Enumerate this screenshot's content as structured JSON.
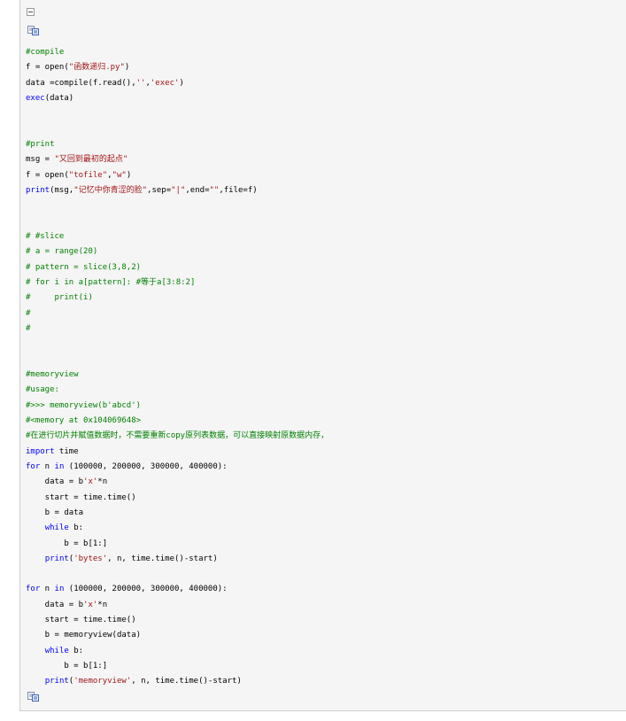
{
  "toolbar": {
    "collapse_icon": "minus-box-icon",
    "copy_icon": "copy-code-icon"
  },
  "colors": {
    "comment": "#008000",
    "keyword": "#0000ff",
    "string": "#a31515",
    "plain": "#000000",
    "background": "#f5f5f5",
    "border": "#cfcfcf"
  },
  "code": [
    [
      {
        "t": "#compile",
        "c": "c"
      }
    ],
    [
      {
        "t": "f = open(",
        "c": ""
      },
      {
        "t": "\"函数递归.py\"",
        "c": "s"
      },
      {
        "t": ")",
        "c": ""
      }
    ],
    [
      {
        "t": "data =compile(f.read(),",
        "c": ""
      },
      {
        "t": "''",
        "c": "s"
      },
      {
        "t": ",",
        "c": ""
      },
      {
        "t": "'exec'",
        "c": "s"
      },
      {
        "t": ")",
        "c": ""
      }
    ],
    [
      {
        "t": "exec",
        "c": "k"
      },
      {
        "t": "(data)",
        "c": ""
      }
    ],
    [],
    [],
    [
      {
        "t": "#print",
        "c": "c"
      }
    ],
    [
      {
        "t": "msg = ",
        "c": ""
      },
      {
        "t": "\"又回到最初的起点\"",
        "c": "s"
      }
    ],
    [
      {
        "t": "f = open(",
        "c": ""
      },
      {
        "t": "\"tofile\"",
        "c": "s"
      },
      {
        "t": ",",
        "c": ""
      },
      {
        "t": "\"w\"",
        "c": "s"
      },
      {
        "t": ")",
        "c": ""
      }
    ],
    [
      {
        "t": "print",
        "c": "k"
      },
      {
        "t": "(msg,",
        "c": ""
      },
      {
        "t": "\"记忆中你青涩的脸\"",
        "c": "s"
      },
      {
        "t": ",sep=",
        "c": ""
      },
      {
        "t": "\"|\"",
        "c": "s"
      },
      {
        "t": ",end=",
        "c": ""
      },
      {
        "t": "\"\"",
        "c": "s"
      },
      {
        "t": ",file=f)",
        "c": ""
      }
    ],
    [],
    [],
    [
      {
        "t": "# #slice",
        "c": "c"
      }
    ],
    [
      {
        "t": "# a = range(20)",
        "c": "c"
      }
    ],
    [
      {
        "t": "# pattern = slice(3,8,2)",
        "c": "c"
      }
    ],
    [
      {
        "t": "# for i in a[pattern]: #等于a[3:8:2]",
        "c": "c"
      }
    ],
    [
      {
        "t": "#     print(i)",
        "c": "c"
      }
    ],
    [
      {
        "t": "#",
        "c": "c"
      }
    ],
    [
      {
        "t": "#",
        "c": "c"
      }
    ],
    [],
    [],
    [
      {
        "t": "#memoryview",
        "c": "c"
      }
    ],
    [
      {
        "t": "#usage:",
        "c": "c"
      }
    ],
    [
      {
        "t": "#>>> memoryview(b'abcd')",
        "c": "c"
      }
    ],
    [
      {
        "t": "#<memory at 0x104069648>",
        "c": "c"
      }
    ],
    [
      {
        "t": "#在进行切片并赋值数据时，不需要重新copy原列表数据，可以直接映射原数据内存，",
        "c": "c"
      }
    ],
    [
      {
        "t": "import",
        "c": "k"
      },
      {
        "t": " time",
        "c": ""
      }
    ],
    [
      {
        "t": "for",
        "c": "k"
      },
      {
        "t": " n ",
        "c": ""
      },
      {
        "t": "in",
        "c": "k"
      },
      {
        "t": " (100000, 200000, 300000, 400000):",
        "c": ""
      }
    ],
    [
      {
        "t": "    data = b",
        "c": ""
      },
      {
        "t": "'x'",
        "c": "s"
      },
      {
        "t": "*n",
        "c": ""
      }
    ],
    [
      {
        "t": "    start = time.time()",
        "c": ""
      }
    ],
    [
      {
        "t": "    b = data",
        "c": ""
      }
    ],
    [
      {
        "t": "    ",
        "c": ""
      },
      {
        "t": "while",
        "c": "k"
      },
      {
        "t": " b:",
        "c": ""
      }
    ],
    [
      {
        "t": "        b = b[1:]",
        "c": ""
      }
    ],
    [
      {
        "t": "    ",
        "c": ""
      },
      {
        "t": "print",
        "c": "k"
      },
      {
        "t": "(",
        "c": ""
      },
      {
        "t": "'bytes'",
        "c": "s"
      },
      {
        "t": ", n, time.time()-start)",
        "c": ""
      }
    ],
    [],
    [
      {
        "t": "for",
        "c": "k"
      },
      {
        "t": " n ",
        "c": ""
      },
      {
        "t": "in",
        "c": "k"
      },
      {
        "t": " (100000, 200000, 300000, 400000):",
        "c": ""
      }
    ],
    [
      {
        "t": "    data = b",
        "c": ""
      },
      {
        "t": "'x'",
        "c": "s"
      },
      {
        "t": "*n",
        "c": ""
      }
    ],
    [
      {
        "t": "    start = time.time()",
        "c": ""
      }
    ],
    [
      {
        "t": "    b = memoryview(data)",
        "c": ""
      }
    ],
    [
      {
        "t": "    ",
        "c": ""
      },
      {
        "t": "while",
        "c": "k"
      },
      {
        "t": " b:",
        "c": ""
      }
    ],
    [
      {
        "t": "        b = b[1:]",
        "c": ""
      }
    ],
    [
      {
        "t": "    ",
        "c": ""
      },
      {
        "t": "print",
        "c": "k"
      },
      {
        "t": "(",
        "c": ""
      },
      {
        "t": "'memoryview'",
        "c": "s"
      },
      {
        "t": ", n, time.time()-start)",
        "c": ""
      }
    ]
  ]
}
